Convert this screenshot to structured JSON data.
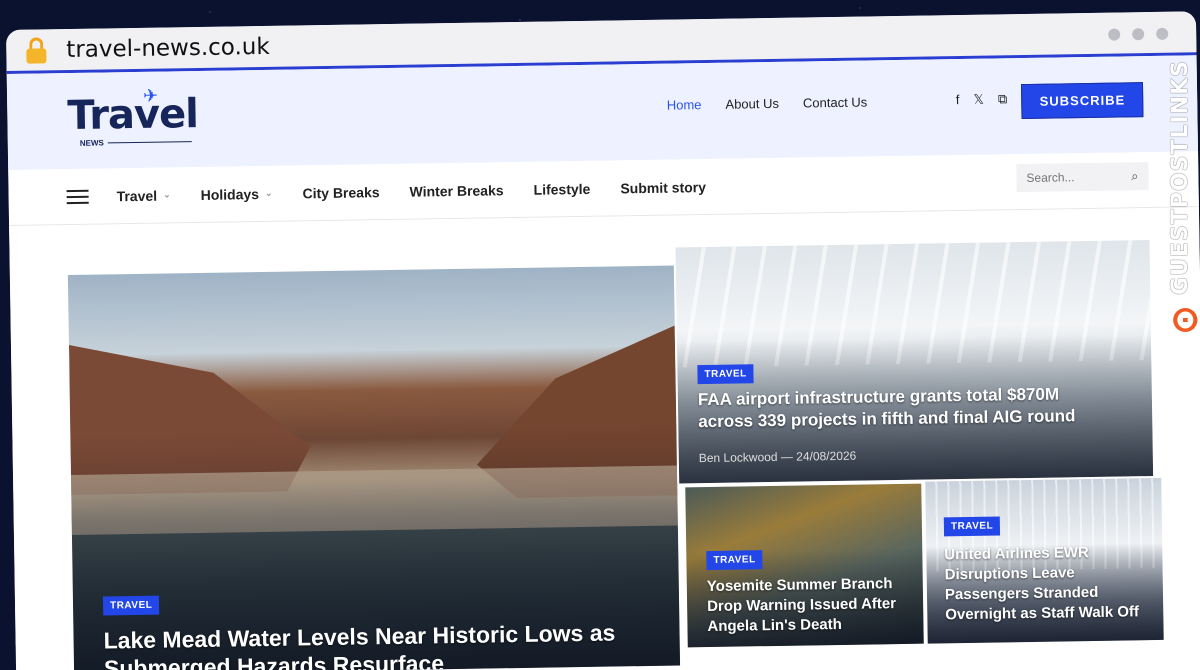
{
  "browser": {
    "url": "travel-news.co.uk"
  },
  "logo": {
    "word": "Travel",
    "sub": "NEWS"
  },
  "topnav": {
    "items": [
      "Home",
      "About Us",
      "Contact Us"
    ]
  },
  "social": {
    "icons": [
      "facebook-icon",
      "x-icon",
      "rss-icon"
    ],
    "glyphs": [
      "f",
      "𝕏",
      "⧉"
    ]
  },
  "subscribe": "SUBSCRIBE",
  "mainnav": {
    "items": [
      {
        "label": "Travel",
        "dropdown": true
      },
      {
        "label": "Holidays",
        "dropdown": true
      },
      {
        "label": "City Breaks",
        "dropdown": false
      },
      {
        "label": "Winter Breaks",
        "dropdown": false
      },
      {
        "label": "Lifestyle",
        "dropdown": false
      },
      {
        "label": "Submit story",
        "dropdown": false
      }
    ]
  },
  "search": {
    "placeholder": "Search..."
  },
  "cards": [
    {
      "badge": "TRAVEL",
      "title": "Lake Mead Water Levels Near Historic Lows as Submerged Hazards Resurface"
    },
    {
      "badge": "TRAVEL",
      "title": "FAA airport infrastructure grants total $870M across 339 projects in fifth and final AIG round",
      "author": "Ben Lockwood",
      "sep": "—",
      "date": "24/08/2026"
    },
    {
      "badge": "TRAVEL",
      "title": "Yosemite Summer Branch Drop Warning Issued After Angela Lin's Death"
    },
    {
      "badge": "TRAVEL",
      "title": "United Airlines EWR Disruptions Leave Passengers Stranded Overnight as Staff Walk Off"
    }
  ],
  "sidebrand": "GUESTPOSTLINKS",
  "colors": {
    "accent": "#2246e8",
    "navy": "#16255a",
    "brand_orange": "#f15a22"
  }
}
